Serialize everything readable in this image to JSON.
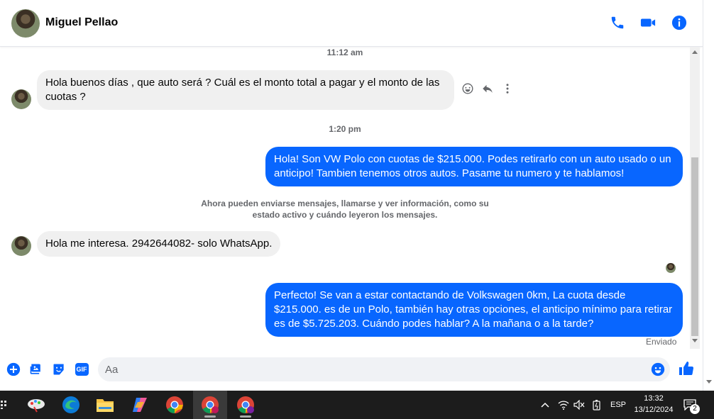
{
  "header": {
    "contact_name": "Miguel Pellao"
  },
  "thread": {
    "timestamps": [
      "11:12 am",
      "1:20 pm"
    ],
    "messages": [
      {
        "direction": "incoming",
        "text": "Hola buenos días , que auto será ? Cuál es el monto total a pagar y el monto de las cuotas ?"
      },
      {
        "direction": "outgoing",
        "text": "Hola! Son VW Polo con cuotas de $215.000. Podes retirarlo con un auto usado o un anticipo! Tambien tenemos otros autos. Pasame tu numero y te hablamos!"
      },
      {
        "direction": "incoming",
        "text": "Hola me interesa. 2942644082- solo WhatsApp."
      },
      {
        "direction": "outgoing",
        "text": "Perfecto!  Se van a estar contactando de Volkswagen 0km, La cuota desde $215.000. es de un Polo, también hay otras opciones, el anticipo mínimo para retirar es de $5.725.203. Cuándo podes hablar? A la mañana o a la tarde?"
      }
    ],
    "notice": "Ahora pueden enviarse mensajes, llamarse y ver información, como su estado activo y cuándo leyeron los mensajes.",
    "status": "Enviado"
  },
  "composer": {
    "placeholder": "Aa",
    "gif_label": "GIF"
  },
  "taskbar": {
    "language": "ESP",
    "time": "13:32",
    "date": "13/12/2024",
    "notification_count": "2"
  },
  "colors": {
    "accent": "#0866ff",
    "incoming_bubble": "#f0f0f0",
    "taskbar": "#1c1c1c"
  }
}
